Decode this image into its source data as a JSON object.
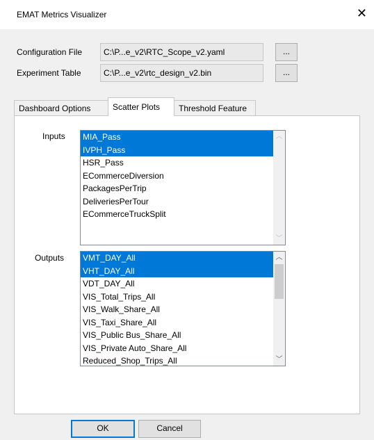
{
  "window": {
    "title": "EMAT Metrics Visualizer",
    "close_glyph": "✕"
  },
  "config": {
    "label": "Configuration File",
    "value": "C:\\P...e_v2\\RTC_Scope_v2.yaml",
    "browse_label": "..."
  },
  "experiment": {
    "label": "Experiment Table",
    "value": "C:\\P...e_v2\\rtc_design_v2.bin",
    "browse_label": "..."
  },
  "tabs": [
    {
      "label": "Dashboard Options",
      "active": false
    },
    {
      "label": "Scatter Plots",
      "active": true
    },
    {
      "label": "Threshold Feature",
      "active": false
    }
  ],
  "inputs": {
    "label": "Inputs",
    "items": [
      {
        "text": "MIA_Pass",
        "selected": true
      },
      {
        "text": "IVPH_Pass",
        "selected": true
      },
      {
        "text": "HSR_Pass",
        "selected": false
      },
      {
        "text": "ECommerceDiversion",
        "selected": false
      },
      {
        "text": "PackagesPerTrip",
        "selected": false
      },
      {
        "text": "DeliveriesPerTour",
        "selected": false
      },
      {
        "text": "ECommerceTruckSplit",
        "selected": false
      }
    ]
  },
  "outputs": {
    "label": "Outputs",
    "items": [
      {
        "text": "VMT_DAY_All",
        "selected": true
      },
      {
        "text": "VHT_DAY_All",
        "selected": true
      },
      {
        "text": "VDT_DAY_All",
        "selected": false
      },
      {
        "text": "VIS_Total_Trips_All",
        "selected": false
      },
      {
        "text": "VIS_Walk_Share_All",
        "selected": false
      },
      {
        "text": "VIS_Taxi_Share_All",
        "selected": false
      },
      {
        "text": "VIS_Public Bus_Share_All",
        "selected": false
      },
      {
        "text": "VIS_Private Auto_Share_All",
        "selected": false
      },
      {
        "text": "Reduced_Shop_Trips_All",
        "selected": false
      }
    ]
  },
  "buttons": {
    "ok": "OK",
    "cancel": "Cancel"
  },
  "colors": {
    "selection": "#0078d7",
    "default_button_border": "#0078d7"
  }
}
